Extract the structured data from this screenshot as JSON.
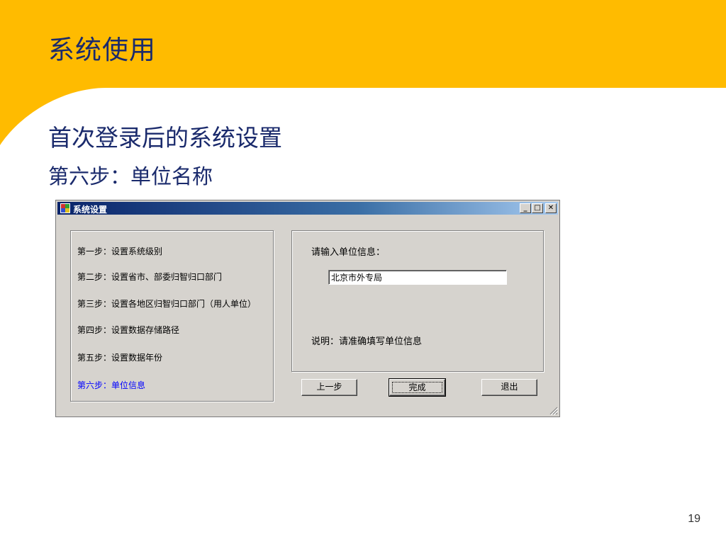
{
  "slide": {
    "title": "系统使用",
    "heading": "首次登录后的系统设置",
    "subheading": "第六步：单位名称",
    "page_number": "19",
    "accent_color": "#ffbb00"
  },
  "dialog": {
    "title": "系统设置",
    "window_buttons": {
      "minimize": "_",
      "maximize": "□",
      "close": "✕"
    },
    "steps": [
      "第一步：设置系统级别",
      "第二步：设置省市、部委归智归口部门",
      "第三步：设置各地区归智归口部门（用人单位）",
      "第四步：设置数据存储路径",
      "第五步：设置数据年份",
      "第六步：单位信息"
    ],
    "active_step_color": "#0000ff",
    "info_label": "请输入单位信息：",
    "unit_value": "北京市外专局",
    "note": "说明：请准确填写单位信息",
    "buttons": {
      "prev": "上一步",
      "finish": "完成",
      "exit": "退出"
    }
  }
}
